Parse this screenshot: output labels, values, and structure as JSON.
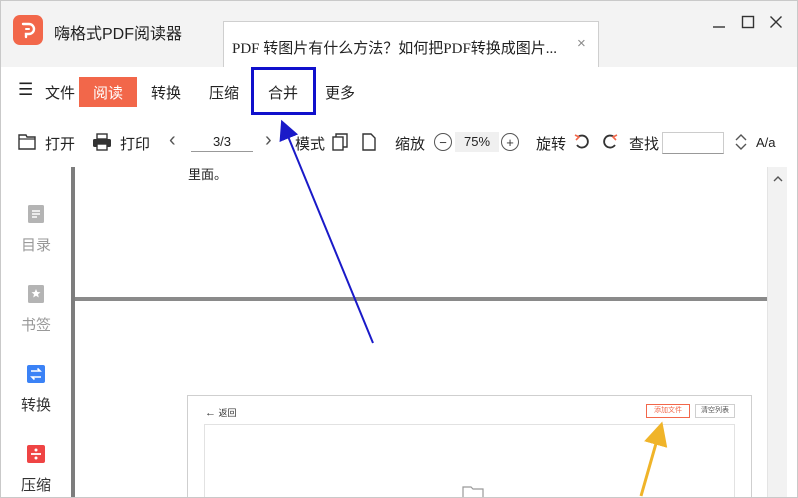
{
  "app": {
    "title": "嗨格式PDF阅读器",
    "logo_letter": "P",
    "brand_color": "#f2674a"
  },
  "tab": {
    "label": "PDF 转图片有什么方法？如何把PDF转换成图片...",
    "close_glyph": "×"
  },
  "menu": {
    "hamburger_glyph": "☰",
    "file": "文件",
    "read": "阅读",
    "convert": "转换",
    "compress": "压缩",
    "merge": "合并",
    "more": "更多"
  },
  "toolbar": {
    "open": "打开",
    "print": "打印",
    "prev_glyph": "‹",
    "page": "3/3",
    "next_glyph": "›",
    "mode": "模式",
    "zoom_label": "缩放",
    "zoom_minus": "−",
    "zoom_value": "75%",
    "zoom_plus": "+",
    "rotate": "旋转",
    "find": "查找",
    "font_glyph": "A/a"
  },
  "sidebar": {
    "items": [
      {
        "label": "目录",
        "icon": "toc-icon",
        "active": false
      },
      {
        "label": "书签",
        "icon": "bookmark-icon",
        "active": false
      },
      {
        "label": "转换",
        "icon": "convert-icon",
        "active": true
      },
      {
        "label": "压缩",
        "icon": "compress-icon",
        "active": true
      }
    ]
  },
  "document": {
    "text_line": "里面。",
    "embedded": {
      "back": "返回",
      "add_file": "添加文件",
      "clear_list": "清空列表"
    }
  },
  "colors": {
    "highlight_box": "#1010cc",
    "arrow_blue": "#1a1ac8",
    "arrow_yellow": "#f0b429",
    "convert_icon": "#3b82f6",
    "compress_icon": "#ef4444"
  }
}
